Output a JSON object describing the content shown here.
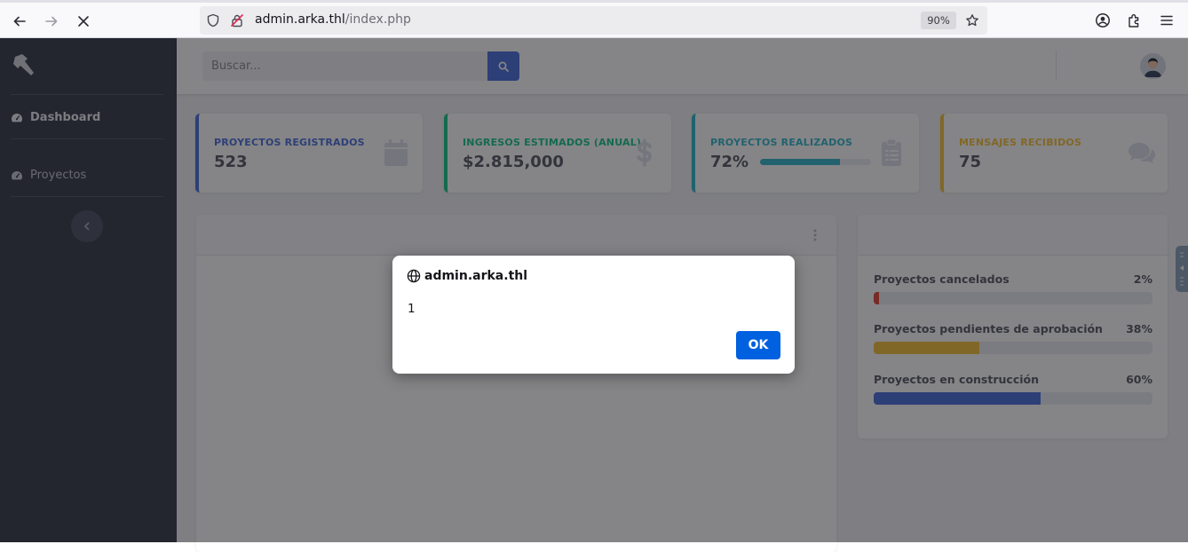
{
  "browser": {
    "url_domain": "admin.arka.thl",
    "url_path": "/index.php",
    "zoom": "90%"
  },
  "sidebar": {
    "items": [
      {
        "label": "Dashboard",
        "icon": "tachometer-icon"
      },
      {
        "label": "Proyectos",
        "icon": "tachometer-icon"
      }
    ]
  },
  "topbar": {
    "search_placeholder": "Buscar..."
  },
  "cards": [
    {
      "title": "PROYECTOS REGISTRADOS",
      "value": "523",
      "color": "#4e73df",
      "icon": "calendar-icon"
    },
    {
      "title": "INGRESOS ESTIMADOS (ANUAL)",
      "value": "$2.815,000",
      "color": "#1cc88a",
      "icon": "dollar-icon"
    },
    {
      "title": "PROYECTOS REALIZADOS",
      "value": "72%",
      "color": "#36b9cc",
      "icon": "clipboard-list-icon",
      "progress": 0.72
    },
    {
      "title": "MENSAJES RECIBIDOS",
      "value": "75",
      "color": "#f6c23e",
      "icon": "comments-icon"
    }
  ],
  "project_status": [
    {
      "label": "Proyectos cancelados",
      "pct": "2%",
      "value": 0.02,
      "color": "#e74a3b"
    },
    {
      "label": "Proyectos pendientes de aprobación",
      "pct": "38%",
      "value": 0.38,
      "color": "#f6c23e"
    },
    {
      "label": "Proyectos en construcción",
      "pct": "60%",
      "value": 0.6,
      "color": "#4e73df"
    }
  ],
  "dialog": {
    "origin": "admin.arka.thl",
    "message": "1",
    "ok_label": "OK"
  }
}
